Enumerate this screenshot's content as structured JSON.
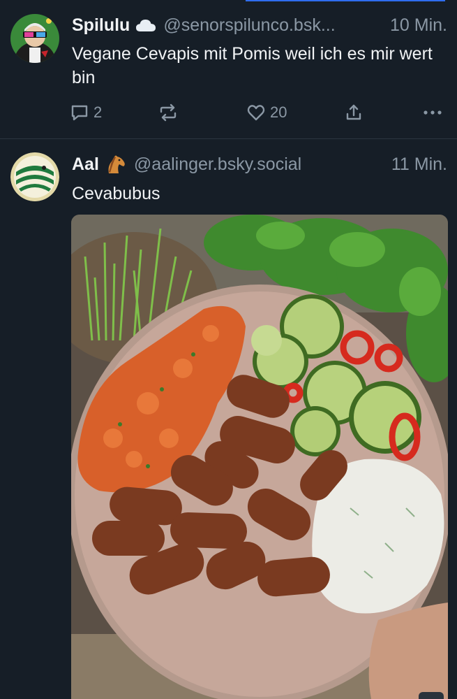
{
  "post1": {
    "author": "Spilulu",
    "author_emoji": "cloud-icon",
    "handle": "@senorspilunco.bsk...",
    "time": "10 Min.",
    "text": "Vegane Cevapis mit Pomis weil ich es mir wert bin",
    "replies": "2",
    "likes": "20"
  },
  "post2": {
    "author": "Aal",
    "author_emoji": "horse-icon",
    "handle": "@aalinger.bsky.social",
    "time": "11 Min.",
    "text": "Cevabubus",
    "image": "food-plate-photo"
  },
  "colors": {
    "background": "#161e27",
    "muted": "#8b98a5",
    "text": "#f1f3f5",
    "accent": "#2f6df0"
  }
}
